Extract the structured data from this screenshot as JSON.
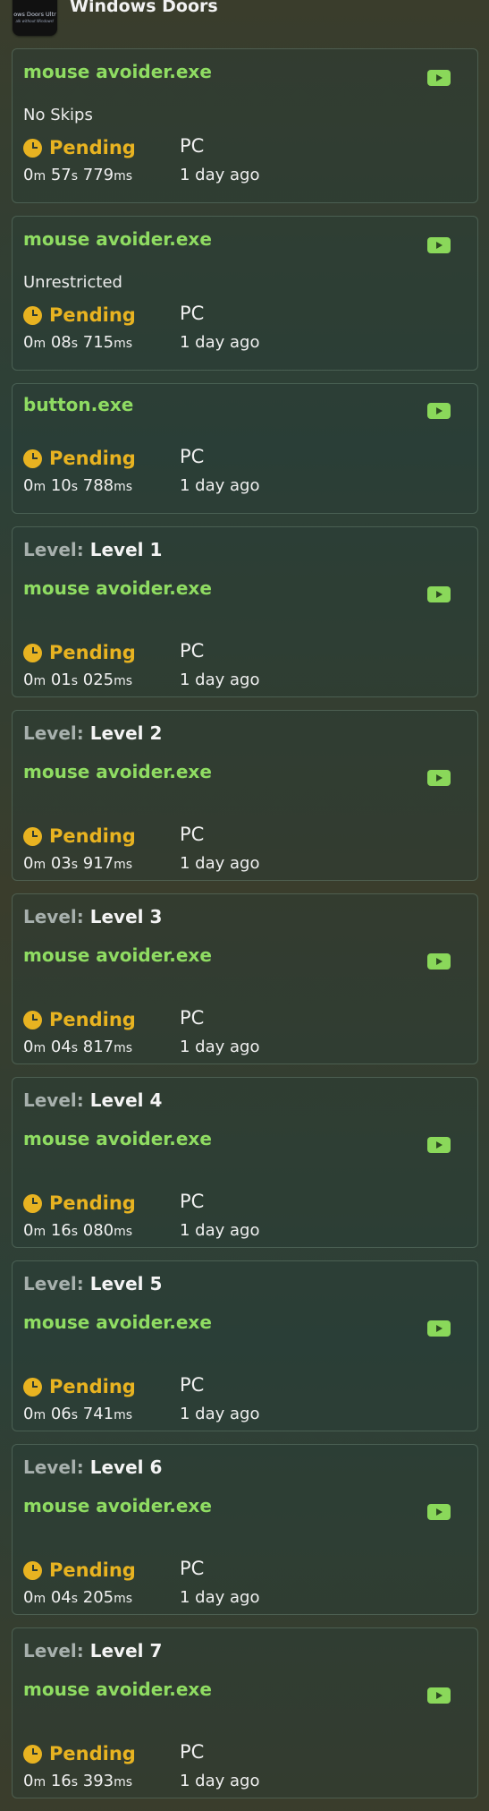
{
  "header": {
    "thumb_line1": "ows Doors Ultr",
    "thumb_line2": "alk without Windows!",
    "game_title": "Windows Doors"
  },
  "level_key": "Level:",
  "status_label": "Pending",
  "runs": [
    {
      "category": "mouse avoider.exe",
      "subcategory": "No Skips",
      "status": "Pending",
      "platform": "PC",
      "time": {
        "m": "0",
        "s": "57",
        "ms": "779"
      },
      "ago": "1 day ago"
    },
    {
      "category": "mouse avoider.exe",
      "subcategory": "Unrestricted",
      "status": "Pending",
      "platform": "PC",
      "time": {
        "m": "0",
        "s": "08",
        "ms": "715"
      },
      "ago": "1 day ago"
    },
    {
      "category": "button.exe",
      "status": "Pending",
      "platform": "PC",
      "time": {
        "m": "0",
        "s": "10",
        "ms": "788"
      },
      "ago": "1 day ago"
    },
    {
      "level": "Level 1",
      "category": "mouse avoider.exe",
      "status": "Pending",
      "platform": "PC",
      "time": {
        "m": "0",
        "s": "01",
        "ms": "025"
      },
      "ago": "1 day ago"
    },
    {
      "level": "Level 2",
      "category": "mouse avoider.exe",
      "status": "Pending",
      "platform": "PC",
      "time": {
        "m": "0",
        "s": "03",
        "ms": "917"
      },
      "ago": "1 day ago"
    },
    {
      "level": "Level 3",
      "category": "mouse avoider.exe",
      "status": "Pending",
      "platform": "PC",
      "time": {
        "m": "0",
        "s": "04",
        "ms": "817"
      },
      "ago": "1 day ago"
    },
    {
      "level": "Level 4",
      "category": "mouse avoider.exe",
      "status": "Pending",
      "platform": "PC",
      "time": {
        "m": "0",
        "s": "16",
        "ms": "080"
      },
      "ago": "1 day ago"
    },
    {
      "level": "Level 5",
      "category": "mouse avoider.exe",
      "status": "Pending",
      "platform": "PC",
      "time": {
        "m": "0",
        "s": "06",
        "ms": "741"
      },
      "ago": "1 day ago"
    },
    {
      "level": "Level 6",
      "category": "mouse avoider.exe",
      "status": "Pending",
      "platform": "PC",
      "time": {
        "m": "0",
        "s": "04",
        "ms": "205"
      },
      "ago": "1 day ago"
    },
    {
      "level": "Level 7",
      "category": "mouse avoider.exe",
      "status": "Pending",
      "platform": "PC",
      "time": {
        "m": "0",
        "s": "16",
        "ms": "393"
      },
      "ago": "1 day ago"
    }
  ],
  "colors": {
    "category_green": "#8fdc62",
    "pending_yellow": "#e8b321",
    "video_button": "#8ad85a"
  },
  "icons": {
    "video": "play-video-icon",
    "status": "clock-icon"
  }
}
